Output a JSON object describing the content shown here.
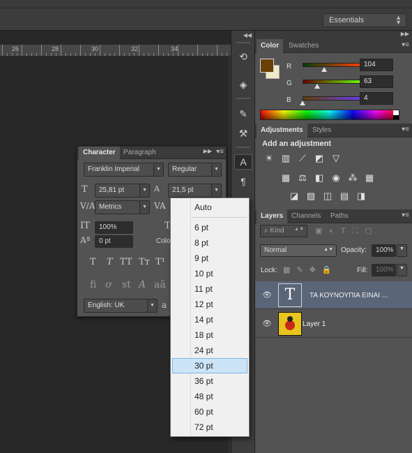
{
  "topbar": {
    "workspace": "Essentials"
  },
  "ruler": {
    "labels": [
      "26",
      "28",
      "30",
      "32",
      "34"
    ]
  },
  "color_panel": {
    "tabs": [
      "Color",
      "Swatches"
    ],
    "r": {
      "label": "R",
      "value": "104"
    },
    "g": {
      "label": "G",
      "value": "63"
    },
    "b": {
      "label": "B",
      "value": "4"
    },
    "foreground": "#683f04"
  },
  "adjustments_panel": {
    "tabs": [
      "Adjustments",
      "Styles"
    ],
    "heading": "Add an adjustment"
  },
  "layers_panel": {
    "tabs": [
      "Layers",
      "Channels",
      "Paths"
    ],
    "kind": "Kind",
    "blend_mode": "Normal",
    "opacity_label": "Opacity:",
    "opacity": "100%",
    "lock_label": "Lock:",
    "fill_label": "Fill:",
    "fill": "100%",
    "layers": [
      {
        "name": "ΤΑ ΚΟΥΝΟΥΠΙΑ ΕΙΝΑΙ ...",
        "type": "text",
        "selected": true
      },
      {
        "name": "Layer 1",
        "type": "image",
        "selected": false
      }
    ]
  },
  "character_panel": {
    "tabs": [
      "Character",
      "Paragraph"
    ],
    "font_family": "Franklin Imperial",
    "font_style": "Regular",
    "font_size": "25,81 pt",
    "leading": "21,5 pt",
    "kerning": "Metrics",
    "vertical_scale": "100%",
    "baseline_shift": "0 pt",
    "color_label": "Colo",
    "language": "English: UK",
    "antialias": "a"
  },
  "dropdown": {
    "options": [
      "Auto",
      "6 pt",
      "8 pt",
      "9 pt",
      "10 pt",
      "11 pt",
      "12 pt",
      "14 pt",
      "18 pt",
      "24 pt",
      "30 pt",
      "36 pt",
      "48 pt",
      "60 pt",
      "72 pt"
    ],
    "highlighted": "30 pt"
  }
}
